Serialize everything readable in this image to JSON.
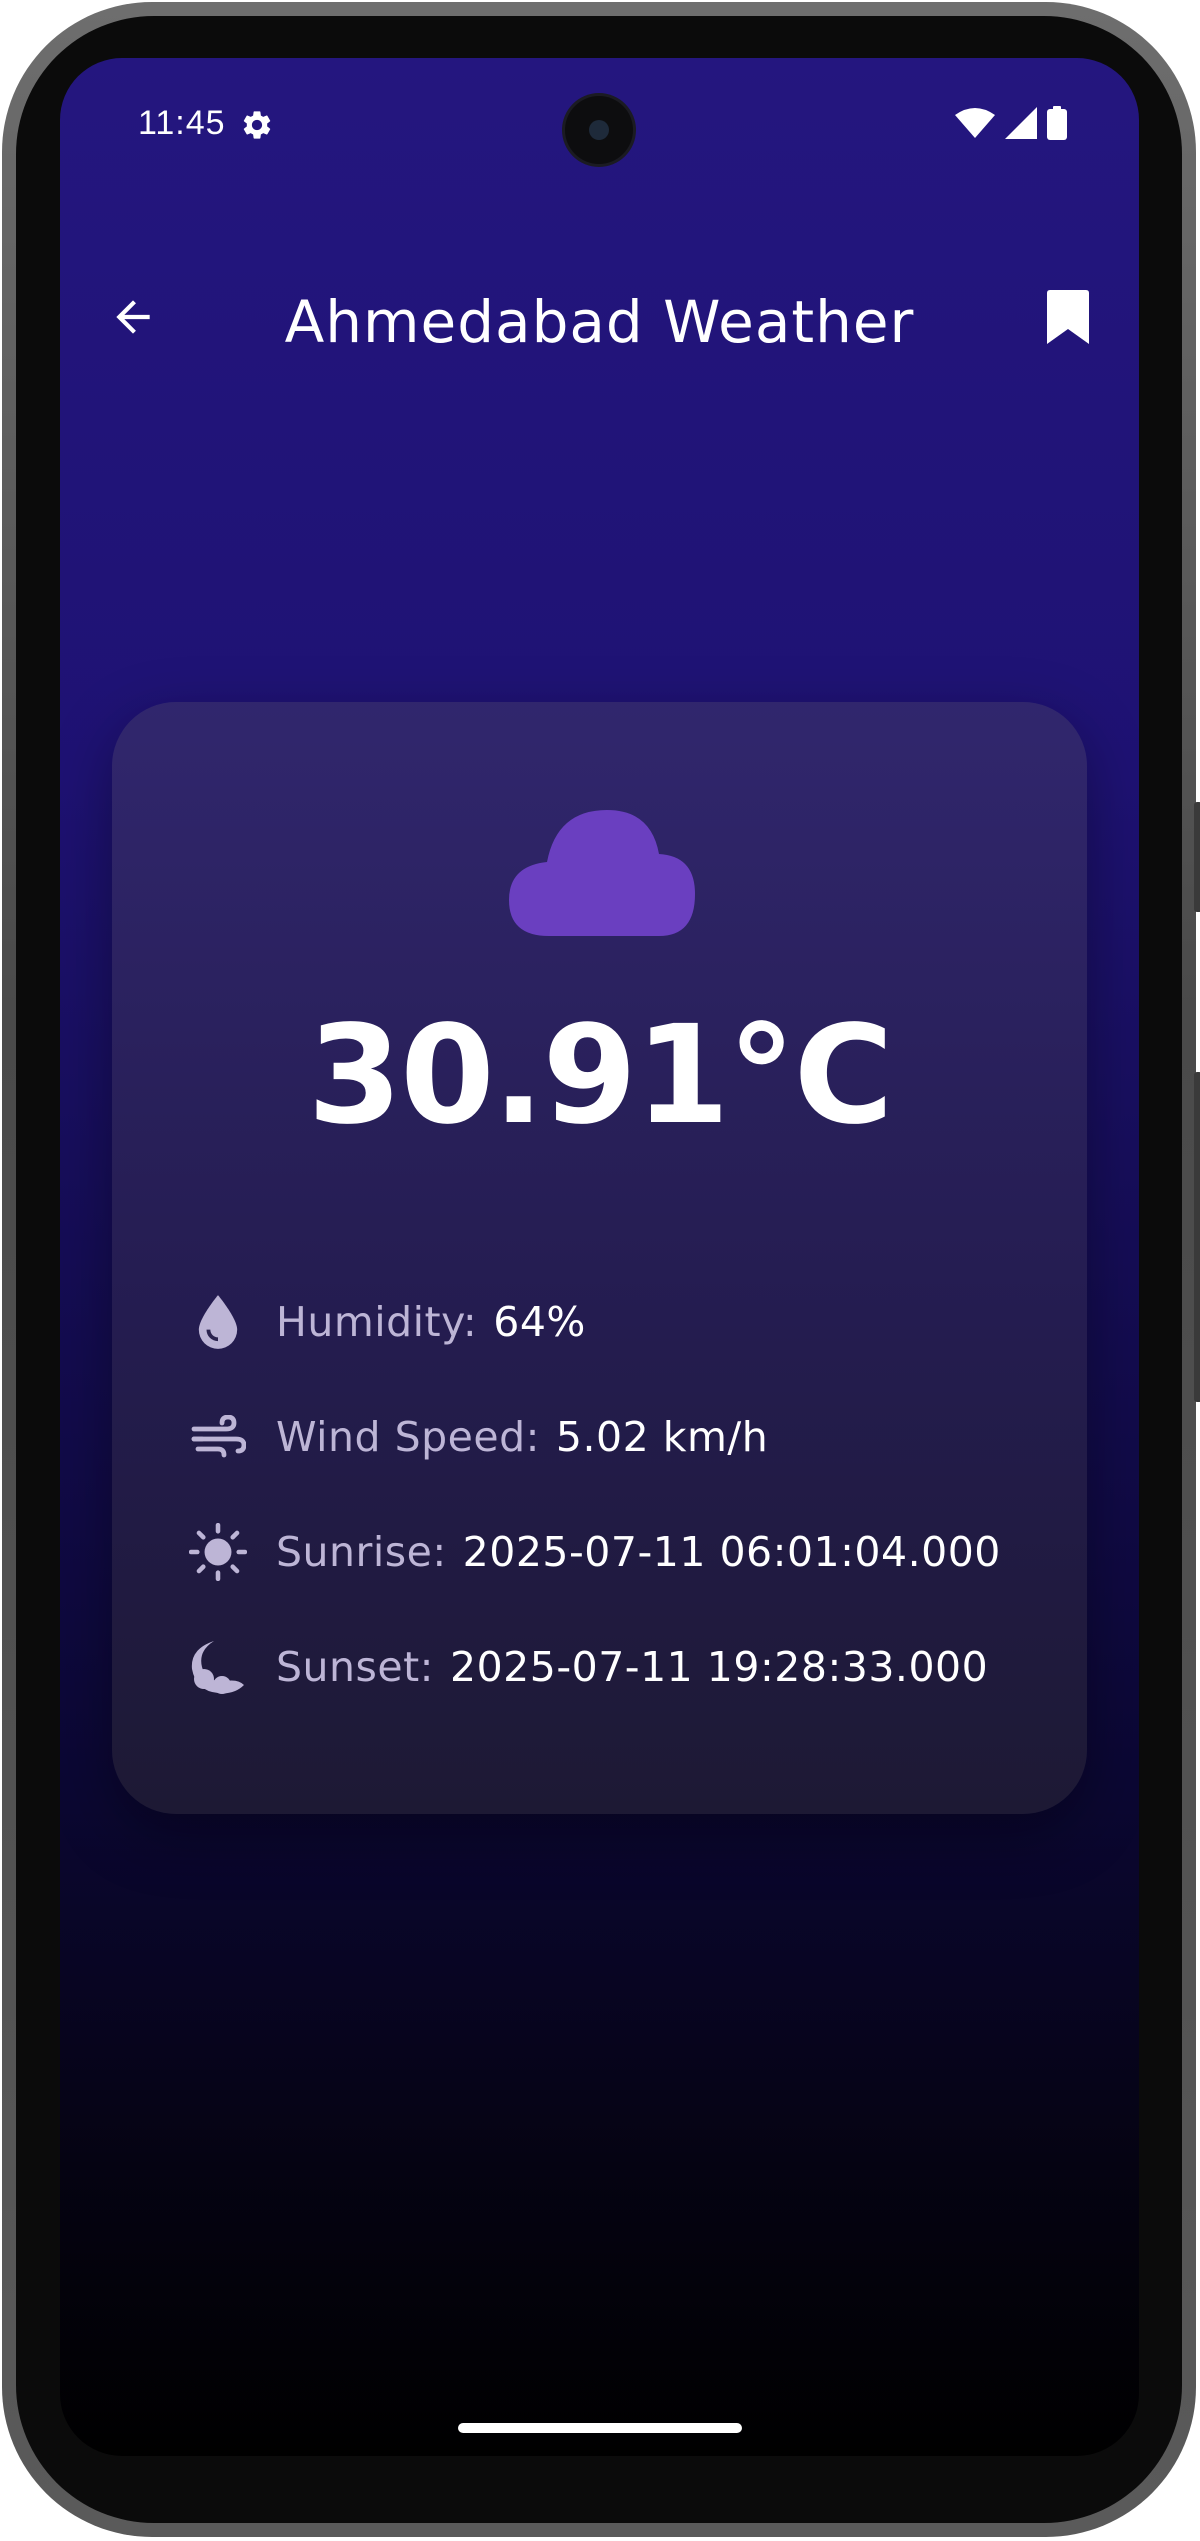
{
  "status_bar": {
    "time": "11:45",
    "settings_icon": "gear-icon",
    "wifi_icon": "wifi-icon",
    "signal_icon": "signal-icon",
    "battery_icon": "battery-icon"
  },
  "app_bar": {
    "title": "Ahmedabad Weather",
    "back_icon": "arrow-left-icon",
    "bookmark_icon": "bookmark-icon"
  },
  "weather": {
    "condition_icon": "cloud-icon",
    "temperature": "30.91°C",
    "details": [
      {
        "icon": "water-drop-icon",
        "label": "Humidity:",
        "value": "64%"
      },
      {
        "icon": "wind-icon",
        "label": "Wind Speed:",
        "value": "5.02 km/h"
      },
      {
        "icon": "sun-icon",
        "label": "Sunrise:",
        "value": "2025-07-11 06:01:04.000"
      },
      {
        "icon": "moon-icon",
        "label": "Sunset:",
        "value": "2025-07-11 19:28:33.000"
      }
    ]
  },
  "colors": {
    "background_top": "#24167f",
    "background_bottom": "#000000",
    "card": "#2a2250",
    "accent_cloud": "#6a3fc0",
    "label": "#bdb5d6",
    "text": "#ffffff"
  }
}
